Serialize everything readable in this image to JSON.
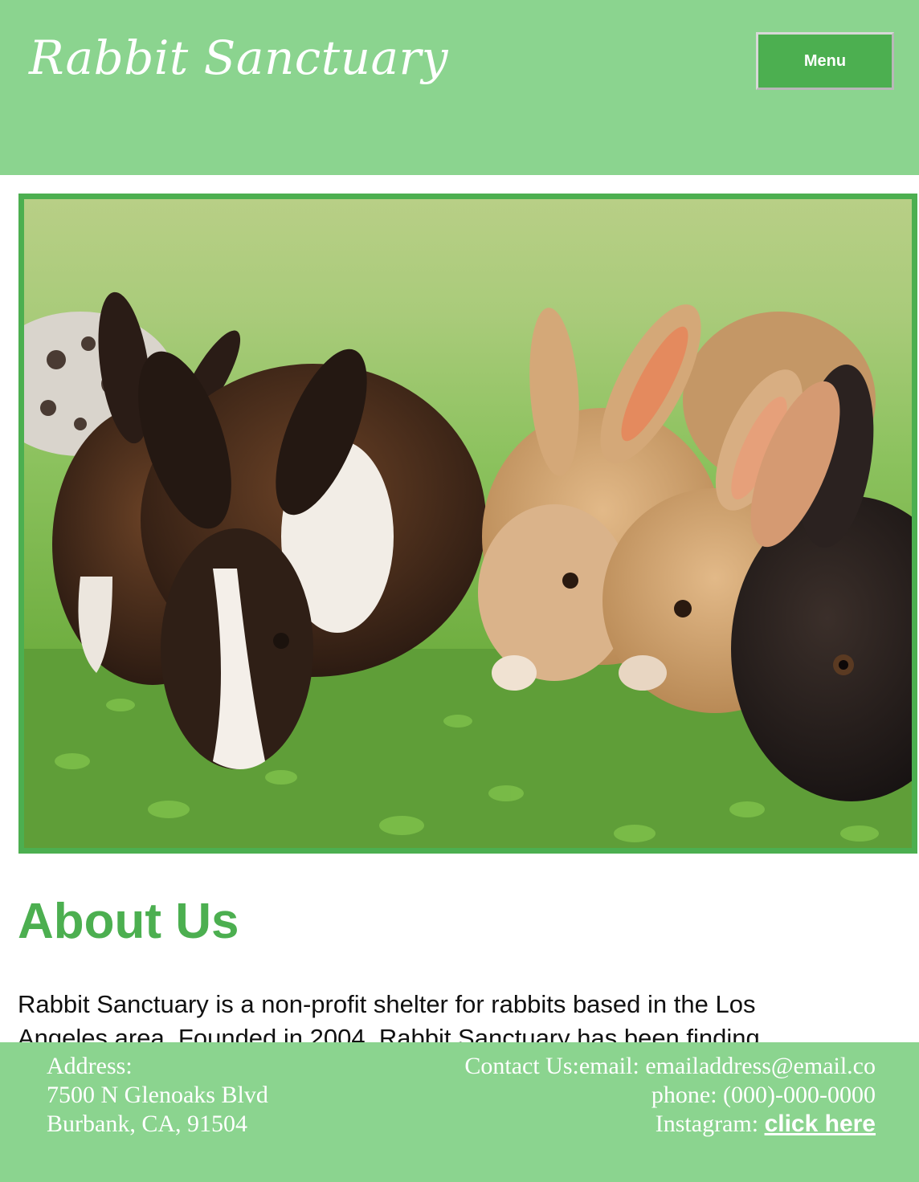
{
  "header": {
    "site_title": "Rabbit Sanctuary",
    "menu_label": "Menu"
  },
  "hero": {
    "image_description": "rabbits-eating-grass-photo"
  },
  "about": {
    "heading": "About Us",
    "text_line_1": "Rabbit Sanctuary is a non-profit shelter for rabbits based in the Los",
    "text_line_2": "Angeles area. Founded in 2004, Rabbit Sanctuary has been finding"
  },
  "footer": {
    "address_label": "Address:",
    "address_line_1": "7500 N Glenoaks Blvd",
    "address_line_2": "Burbank, CA, 91504",
    "contact_line": "Contact Us:email: emailaddress@email.co",
    "phone_line": "phone: (000)-000-0000",
    "instagram_label": "Instagram: ",
    "instagram_link": "click here"
  },
  "colors": {
    "header_bg": "#8bd48f",
    "accent_green": "#4caf50",
    "footer_bg": "#8bd48f"
  }
}
